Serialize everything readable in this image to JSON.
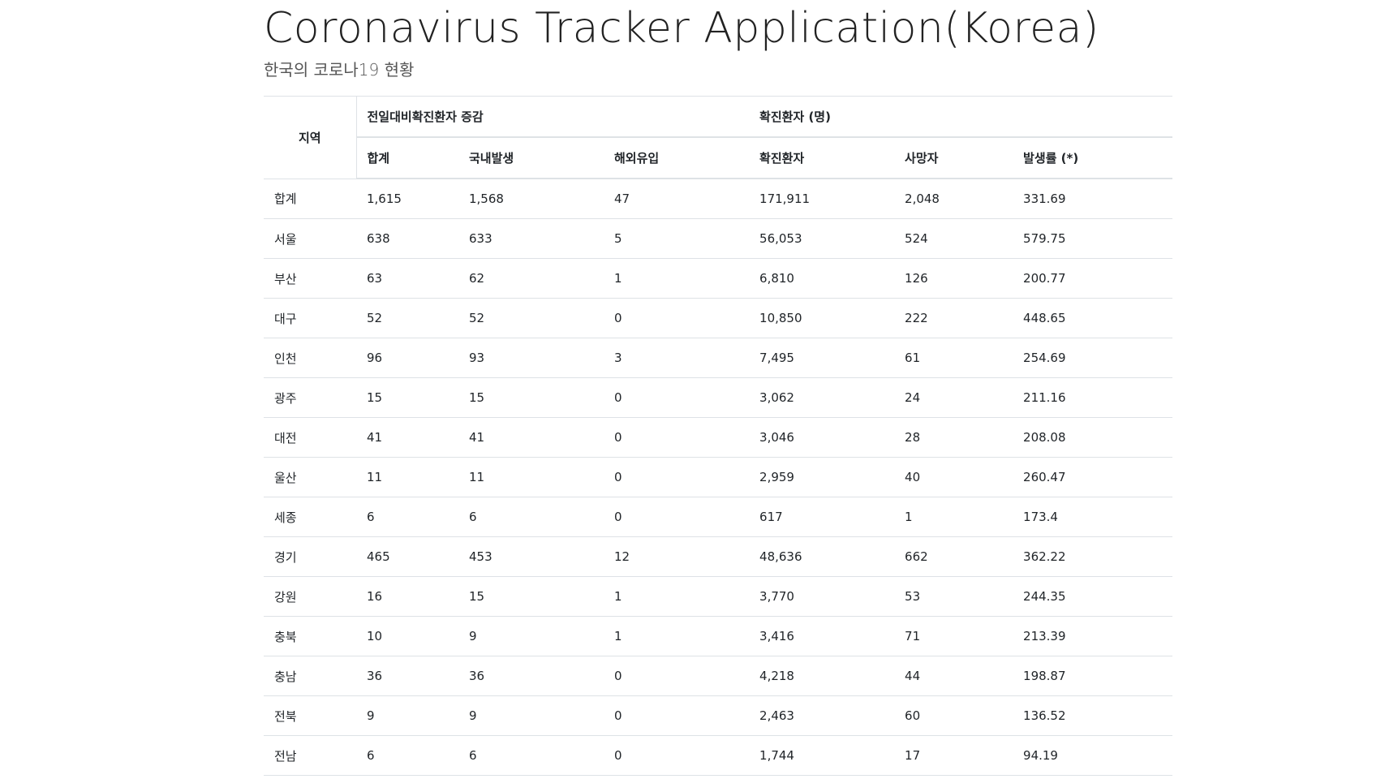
{
  "page": {
    "title": "Coronavirus Tracker Application(Korea)",
    "subtitle": "한국의 코로나19 현황"
  },
  "table": {
    "group_headers": {
      "region": "지역",
      "daily_change": "전일대비확진환자 증감",
      "confirmed": "확진환자 (명)"
    },
    "columns": [
      "합계",
      "국내발생",
      "해외유입",
      "확진환자",
      "사망자",
      "발생률 (*)"
    ],
    "rows": [
      {
        "region": "합계",
        "total": "1,615",
        "domestic": "1,568",
        "overseas": "47",
        "confirmed": "171,911",
        "deaths": "2,048",
        "incidence": "331.69"
      },
      {
        "region": "서울",
        "total": "638",
        "domestic": "633",
        "overseas": "5",
        "confirmed": "56,053",
        "deaths": "524",
        "incidence": "579.75"
      },
      {
        "region": "부산",
        "total": "63",
        "domestic": "62",
        "overseas": "1",
        "confirmed": "6,810",
        "deaths": "126",
        "incidence": "200.77"
      },
      {
        "region": "대구",
        "total": "52",
        "domestic": "52",
        "overseas": "0",
        "confirmed": "10,850",
        "deaths": "222",
        "incidence": "448.65"
      },
      {
        "region": "인천",
        "total": "96",
        "domestic": "93",
        "overseas": "3",
        "confirmed": "7,495",
        "deaths": "61",
        "incidence": "254.69"
      },
      {
        "region": "광주",
        "total": "15",
        "domestic": "15",
        "overseas": "0",
        "confirmed": "3,062",
        "deaths": "24",
        "incidence": "211.16"
      },
      {
        "region": "대전",
        "total": "41",
        "domestic": "41",
        "overseas": "0",
        "confirmed": "3,046",
        "deaths": "28",
        "incidence": "208.08"
      },
      {
        "region": "울산",
        "total": "11",
        "domestic": "11",
        "overseas": "0",
        "confirmed": "2,959",
        "deaths": "40",
        "incidence": "260.47"
      },
      {
        "region": "세종",
        "total": "6",
        "domestic": "6",
        "overseas": "0",
        "confirmed": "617",
        "deaths": "1",
        "incidence": "173.4"
      },
      {
        "region": "경기",
        "total": "465",
        "domestic": "453",
        "overseas": "12",
        "confirmed": "48,636",
        "deaths": "662",
        "incidence": "362.22"
      },
      {
        "region": "강원",
        "total": "16",
        "domestic": "15",
        "overseas": "1",
        "confirmed": "3,770",
        "deaths": "53",
        "incidence": "244.35"
      },
      {
        "region": "충북",
        "total": "10",
        "domestic": "9",
        "overseas": "1",
        "confirmed": "3,416",
        "deaths": "71",
        "incidence": "213.39"
      },
      {
        "region": "충남",
        "total": "36",
        "domestic": "36",
        "overseas": "0",
        "confirmed": "4,218",
        "deaths": "44",
        "incidence": "198.87"
      },
      {
        "region": "전북",
        "total": "9",
        "domestic": "9",
        "overseas": "0",
        "confirmed": "2,463",
        "deaths": "60",
        "incidence": "136.52"
      },
      {
        "region": "전남",
        "total": "6",
        "domestic": "6",
        "overseas": "0",
        "confirmed": "1,744",
        "deaths": "17",
        "incidence": "94.19"
      }
    ]
  }
}
